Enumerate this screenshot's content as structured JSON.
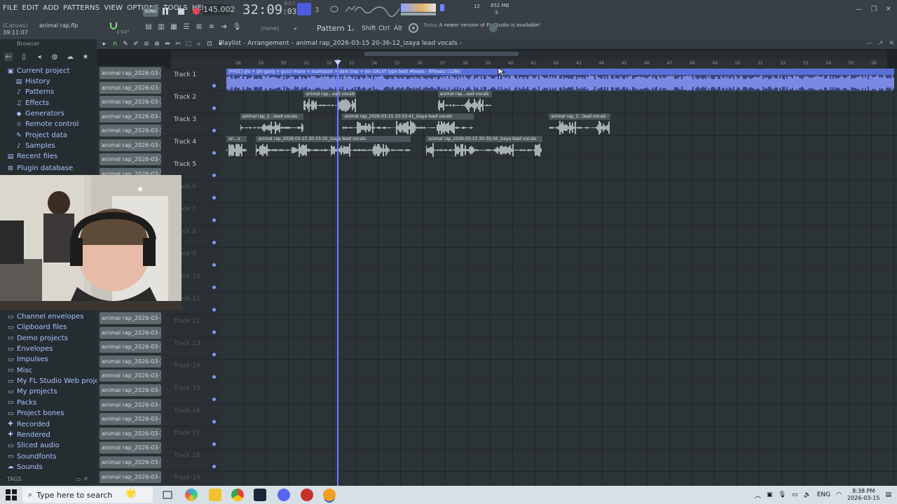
{
  "menu": [
    "FILE",
    "EDIT",
    "ADD",
    "PATTERNS",
    "VIEW",
    "OPTIONS",
    "TOOLS",
    "HELP"
  ],
  "hint": {
    "label": "(Canvas)",
    "file": "animal rap.flp",
    "time": "39:11:07",
    "small": "1'04\""
  },
  "transport": {
    "song_label": "SONG",
    "tempo": "145.002",
    "time_main": "32:09",
    "time_sub": "03",
    "time_sup": "B:S:T"
  },
  "perf": {
    "mem": "852 MB",
    "num": "12",
    "voices": "3"
  },
  "pattern": {
    "none_label": "(none)",
    "pattern_label": "Pattern 1",
    "keys": [
      "Shift",
      "Ctrl",
      "Alt"
    ]
  },
  "news": {
    "when": "Today",
    "text": "A newer version of FL Studio is available!"
  },
  "browser": {
    "title": "Browser",
    "items": [
      {
        "label": "Current project",
        "icon": "folder-open-icon",
        "sub": false
      },
      {
        "label": "History",
        "icon": "history-icon",
        "sub": true
      },
      {
        "label": "Patterns",
        "icon": "patterns-icon",
        "sub": true
      },
      {
        "label": "Effects",
        "icon": "effects-icon",
        "sub": true
      },
      {
        "label": "Generators",
        "icon": "generators-icon",
        "sub": true
      },
      {
        "label": "Remote control",
        "icon": "remote-icon",
        "sub": true
      },
      {
        "label": "Project data",
        "icon": "data-icon",
        "sub": true
      },
      {
        "label": "Samples",
        "icon": "samples-icon",
        "sub": true
      },
      {
        "label": "Recent files",
        "icon": "recent-icon",
        "sub": false
      },
      {
        "label": "Plugin database",
        "icon": "plugin-icon",
        "sub": false
      },
      {
        "label": "Channel envelopes",
        "icon": "folder-icon",
        "sub": false
      },
      {
        "label": "Clipboard files",
        "icon": "folder-icon",
        "sub": false
      },
      {
        "label": "Demo projects",
        "icon": "folder-icon",
        "sub": false
      },
      {
        "label": "Envelopes",
        "icon": "folder-icon",
        "sub": false
      },
      {
        "label": "Impulses",
        "icon": "folder-icon",
        "sub": false
      },
      {
        "label": "Misc",
        "icon": "folder-icon",
        "sub": false
      },
      {
        "label": "My FL Studio Web projects",
        "icon": "folder-icon",
        "sub": false
      },
      {
        "label": "My projects",
        "icon": "folder-icon",
        "sub": false
      },
      {
        "label": "Packs",
        "icon": "folder-icon",
        "sub": false
      },
      {
        "label": "Project bones",
        "icon": "folder-icon",
        "sub": false
      },
      {
        "label": "Recorded",
        "icon": "recorded-icon",
        "sub": false
      },
      {
        "label": "Rendered",
        "icon": "rendered-icon",
        "sub": false
      },
      {
        "label": "Sliced audio",
        "icon": "folder-icon",
        "sub": false
      },
      {
        "label": "Soundfonts",
        "icon": "folder-icon",
        "sub": false
      },
      {
        "label": "Sounds",
        "icon": "sounds-icon",
        "sub": false
      }
    ],
    "tags_label": "TAGS"
  },
  "picker": {
    "clip_label": "animal rap_2026-03-15..."
  },
  "playlist": {
    "title": "Playlist",
    "section": "Arrangement",
    "clip": "animal rap_2026-03-15 20-36-12_izaya lead vocals"
  },
  "ruler": [
    28,
    29,
    30,
    31,
    32,
    33,
    34,
    35,
    36,
    37,
    38,
    39,
    40,
    41,
    42,
    43,
    44,
    45,
    46,
    47,
    48,
    49,
    50,
    51,
    52,
    53,
    54,
    55,
    56
  ],
  "tracks": [
    "Track 1",
    "Track 2",
    "Track 3",
    "Track 4",
    "Track 5",
    "Track 6",
    "Track 7",
    "Track 8",
    "Track 9",
    "Track 10",
    "Track 11",
    "Track 12",
    "Track 13",
    "Track 14",
    "Track 15",
    "Track 16",
    "Track 17",
    "Track 18",
    "Track 19"
  ],
  "clips": [
    {
      "label": "[FREE] glo + glo gang + gucci mane + osamason + dark trap + Ian GALXY type beat #beats - RFbeatz (128k)",
      "track": 0,
      "start_bar": 28.1,
      "end_bar": 57.5,
      "kind": "main"
    },
    {
      "label": "animal rap...ead vocals",
      "track": 1,
      "start_bar": 31.5,
      "end_bar": 33.8,
      "kind": "audio"
    },
    {
      "label": "animal rap...ead vocals",
      "track": 1,
      "start_bar": 37.4,
      "end_bar": 39.8,
      "kind": "audio"
    },
    {
      "label": "animal rap_2...lead vocals",
      "track": 2,
      "start_bar": 28.7,
      "end_bar": 31.5,
      "kind": "audio"
    },
    {
      "label": "animal rap_2026-03-15 20-33-41_izaya lead vocals",
      "track": 2,
      "start_bar": 33.2,
      "end_bar": 39.0,
      "kind": "audio"
    },
    {
      "label": "animal rap_2...lead vocals",
      "track": 2,
      "start_bar": 42.3,
      "end_bar": 45.0,
      "kind": "audio"
    },
    {
      "label": "an...s",
      "track": 3,
      "start_bar": 28.1,
      "end_bar": 29.0,
      "kind": "audio"
    },
    {
      "label": "animal rap_2026-03-15 20-33-20_izaya lead vocals",
      "track": 3,
      "start_bar": 29.4,
      "end_bar": 36.2,
      "kind": "audio"
    },
    {
      "label": "animal rap_2026-03-15 20-35-56_izaya lead vocals",
      "track": 3,
      "start_bar": 36.9,
      "end_bar": 42.0,
      "kind": "audio"
    }
  ],
  "playhead_bar": 33.0,
  "taskbar": {
    "search_placeholder": "Type here to search",
    "lang": "ENG",
    "time": "8:38 PM",
    "date": "2026-03-15"
  },
  "colors": {
    "accent": "#6d7dff",
    "clip_main": "#8a9cff",
    "clip_audio": "#c8d0d4",
    "browser_text": "#a9c2ff"
  }
}
